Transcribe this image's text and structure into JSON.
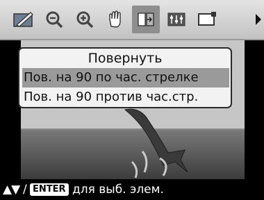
{
  "toolbar": {
    "buttons": [
      {
        "name": "edit-image-icon"
      },
      {
        "name": "zoom-out-icon"
      },
      {
        "name": "zoom-in-icon"
      },
      {
        "name": "hand-pan-icon"
      },
      {
        "name": "rotate-icon",
        "selected": true
      },
      {
        "name": "adjust-sliders-icon"
      },
      {
        "name": "frame-icon"
      },
      {
        "name": "more-right-arrow-icon"
      }
    ]
  },
  "menu": {
    "title": "Повернуть",
    "items": [
      {
        "label": "Пов. на 90 по час. стрелке",
        "selected": true
      },
      {
        "label": "Пов. на 90 против час.стр.",
        "selected": false
      }
    ]
  },
  "hint": {
    "arrows": "▲▼",
    "slash": "/",
    "enter_key": "ENTER",
    "text": "для выб. элем."
  },
  "colors": {
    "toolbar_bg": "#d4d4d4",
    "selected_item_bg": "#9a9a9a",
    "menu_bg": "#f2f2f2",
    "hint_bg": "#000000"
  }
}
